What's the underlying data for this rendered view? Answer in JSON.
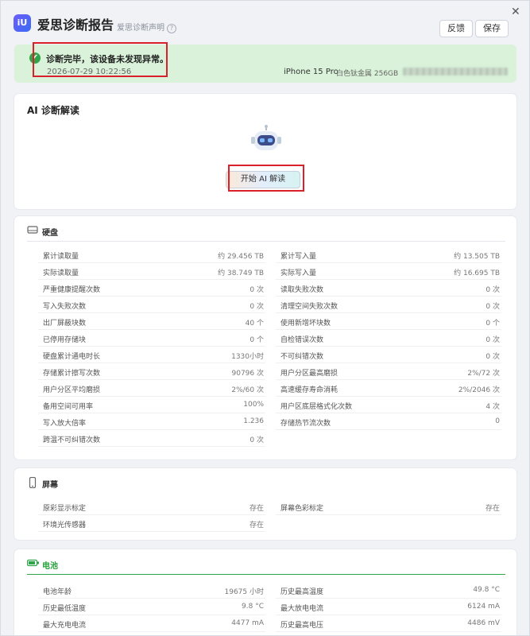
{
  "header": {
    "logo_text": "iU",
    "app_title": "爱思诊断报告",
    "disclaimer": "爱思诊断声明",
    "help": "?",
    "close": "✕",
    "feedback": "反馈",
    "save": "保存"
  },
  "banner": {
    "check": "✔",
    "title": "诊断完毕，该设备未发现异常。",
    "time": "2026-07-29 10:22:56",
    "device": "iPhone 15 Pro",
    "spec": "白色钛金属 256GB"
  },
  "ai": {
    "title": "AI 诊断解读",
    "button": "开始 AI 解读"
  },
  "disk": {
    "title": "硬盘",
    "left": [
      {
        "label": "累计读取量",
        "value": "约 29.456 TB"
      },
      {
        "label": "实际读取量",
        "value": "约 38.749 TB"
      },
      {
        "label": "严重健康提醒次数",
        "value": "0 次"
      },
      {
        "label": "写入失败次数",
        "value": "0 次"
      },
      {
        "label": "出厂屏蔽块数",
        "value": "40 个"
      },
      {
        "label": "已停用存储块",
        "value": "0 个"
      },
      {
        "label": "硬盘累计通电时长",
        "value": "1330小时"
      },
      {
        "label": "存储累计擦写次数",
        "value": "90796 次"
      },
      {
        "label": "用户分区平均磨损",
        "value": "2%/60 次"
      },
      {
        "label": "备用空间可用率",
        "value": "100%"
      },
      {
        "label": "写入放大倍率",
        "value": "1.236"
      },
      {
        "label": "跨温不可纠错次数",
        "value": "0 次"
      }
    ],
    "right": [
      {
        "label": "累计写入量",
        "value": "约 13.505 TB"
      },
      {
        "label": "实际写入量",
        "value": "约 16.695 TB"
      },
      {
        "label": "读取失败次数",
        "value": "0 次"
      },
      {
        "label": "清理空间失败次数",
        "value": "0 次"
      },
      {
        "label": "使用新增坏块数",
        "value": "0 个"
      },
      {
        "label": "自检错误次数",
        "value": "0 次"
      },
      {
        "label": "不可纠错次数",
        "value": "0 次"
      },
      {
        "label": "用户分区最高磨损",
        "value": "2%/72 次"
      },
      {
        "label": "高速缓存寿命消耗",
        "value": "2%/2046 次"
      },
      {
        "label": "用户区底层格式化次数",
        "value": "4 次"
      },
      {
        "label": "存储热节流次数",
        "value": "0"
      }
    ]
  },
  "screen": {
    "title": "屏幕",
    "left": [
      {
        "label": "原彩显示标定",
        "value": "存在"
      },
      {
        "label": "环境光传感器",
        "value": "存在"
      }
    ],
    "right": [
      {
        "label": "屏幕色彩标定",
        "value": "存在"
      }
    ]
  },
  "battery": {
    "title": "电池",
    "left": [
      {
        "label": "电池年龄",
        "value": "19675 小时"
      },
      {
        "label": "历史最低温度",
        "value": "9.8 °C"
      },
      {
        "label": "最大充电电流",
        "value": "4477 mA"
      }
    ],
    "right": [
      {
        "label": "历史最高温度",
        "value": "49.8 °C"
      },
      {
        "label": "最大放电电流",
        "value": "6124 mA"
      },
      {
        "label": "历史最高电压",
        "value": "4486 mV"
      }
    ]
  }
}
